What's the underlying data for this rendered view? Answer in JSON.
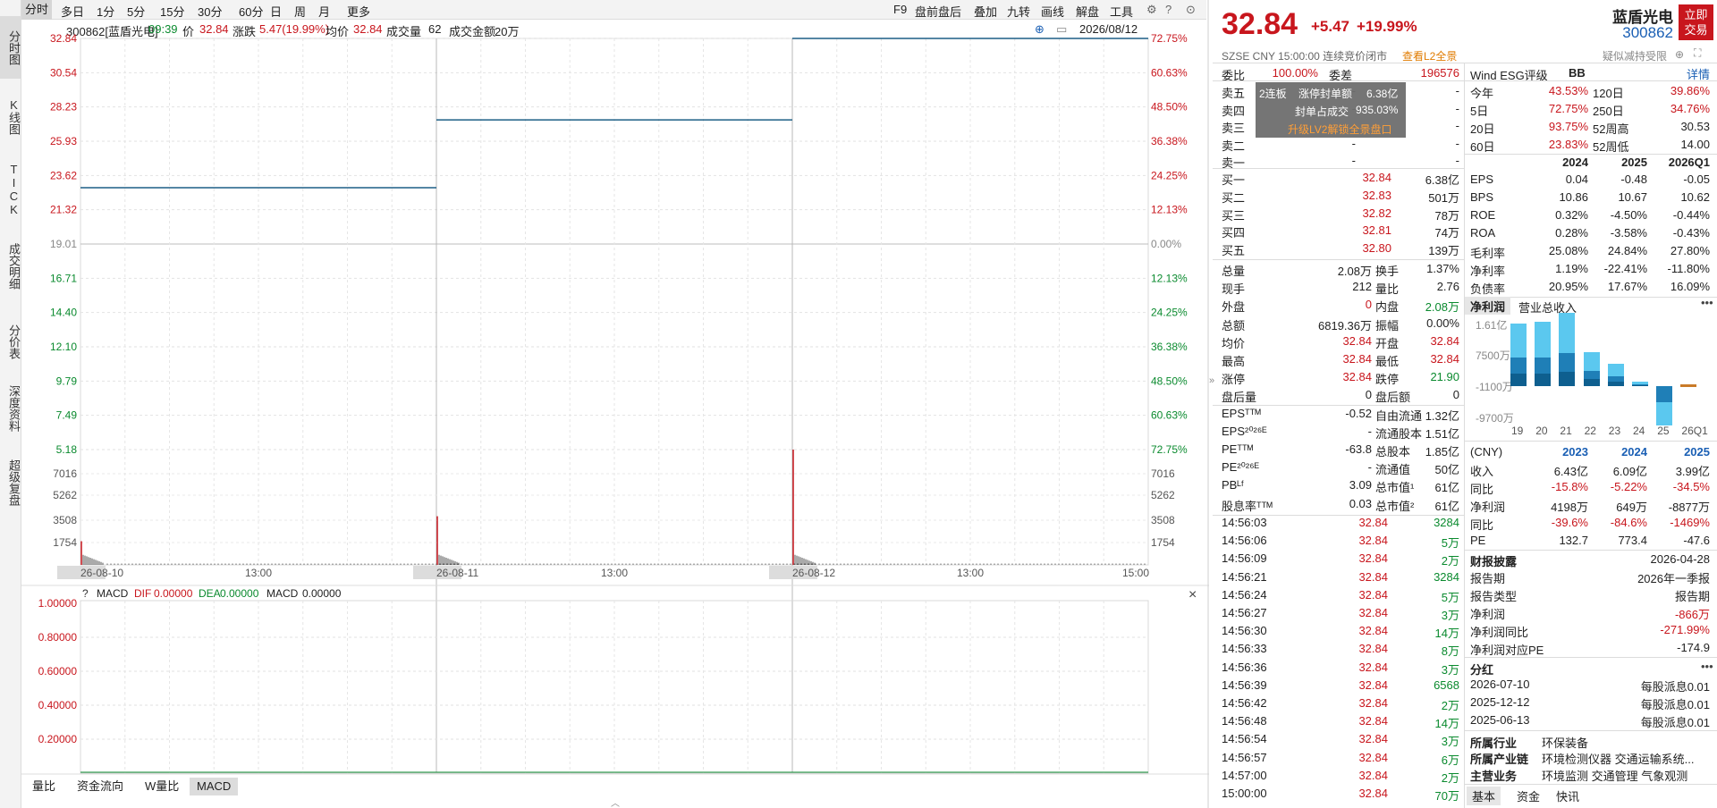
{
  "left_nav": [
    {
      "label": "分时图",
      "active": true
    },
    {
      "label": "K线图"
    },
    {
      "label": "TICK"
    },
    {
      "label": "成交明细"
    },
    {
      "label": "分价表"
    },
    {
      "label": "深度资料"
    },
    {
      "label": "超级复盘"
    }
  ],
  "top_tabs": [
    "分时",
    "多日",
    "1分",
    "5分",
    "15分",
    "30分",
    "60分",
    "日",
    "周",
    "月",
    "更多"
  ],
  "top_right": [
    "F9",
    "盘前盘后",
    "叠加",
    "九转",
    "画线",
    "解盘",
    "工具"
  ],
  "info": {
    "code": "300862[蓝盾光电]",
    "time": "09:39",
    "price_label": "价",
    "price": "32.84",
    "chg_label": "涨跌",
    "chg": "5.47(19.99%)",
    "avg_label": "均价",
    "avg": "32.84",
    "vol_label": "成交量",
    "vol": "62",
    "amt_label": "成交金额",
    "amt": "20万",
    "date": "2026/08/12"
  },
  "chart": {
    "price_ticks": [
      {
        "v": "32.84",
        "c": "red"
      },
      {
        "v": "30.54",
        "c": "red"
      },
      {
        "v": "28.23",
        "c": "red"
      },
      {
        "v": "25.93",
        "c": "red"
      },
      {
        "v": "23.62",
        "c": "red"
      },
      {
        "v": "21.32",
        "c": "red"
      },
      {
        "v": "19.01",
        "c": "gray"
      },
      {
        "v": "16.71",
        "c": "green"
      },
      {
        "v": "14.40",
        "c": "green"
      },
      {
        "v": "12.10",
        "c": "green"
      },
      {
        "v": "9.79",
        "c": "green"
      },
      {
        "v": "7.49",
        "c": "green"
      },
      {
        "v": "5.18",
        "c": "green"
      }
    ],
    "pct_ticks": [
      {
        "v": "72.75%",
        "c": "red"
      },
      {
        "v": "60.63%",
        "c": "red"
      },
      {
        "v": "48.50%",
        "c": "red"
      },
      {
        "v": "36.38%",
        "c": "red"
      },
      {
        "v": "24.25%",
        "c": "red"
      },
      {
        "v": "12.13%",
        "c": "red"
      },
      {
        "v": "0.00%",
        "c": "gray"
      },
      {
        "v": "12.13%",
        "c": "green"
      },
      {
        "v": "24.25%",
        "c": "green"
      },
      {
        "v": "36.38%",
        "c": "green"
      },
      {
        "v": "48.50%",
        "c": "green"
      },
      {
        "v": "60.63%",
        "c": "green"
      },
      {
        "v": "72.75%",
        "c": "green"
      }
    ],
    "vol_ticks": [
      "7016",
      "5262",
      "3508",
      "1754"
    ],
    "time_labels": [
      "26-08-10",
      "13:00",
      "26-08-11",
      "13:00",
      "26-08-12",
      "13:00",
      "15:00"
    ],
    "price_segments": [
      {
        "day": 0,
        "price": 22.8
      },
      {
        "day": 1,
        "price": 27.36
      },
      {
        "day": 2,
        "price": 32.84
      }
    ],
    "price_top": 32.84,
    "price_bottom": 5.18,
    "vol_max": 8770,
    "vol_spikes": [
      {
        "day": 0,
        "v": 1800
      },
      {
        "day": 1,
        "v": 3700
      },
      {
        "day": 2,
        "v": 8770
      }
    ],
    "macd_title": "MACD",
    "macd_dif_label": "DIF",
    "macd_dif": "0.00000",
    "macd_dea_label": "DEA",
    "macd_dea": "0.00000",
    "macd_label": "MACD",
    "macd_val": "0.00000",
    "macd_ticks": [
      "1.00000",
      "0.80000",
      "0.60000",
      "0.40000",
      "0.20000"
    ]
  },
  "bottom_tabs": [
    {
      "label": "量比"
    },
    {
      "label": "资金流向"
    },
    {
      "label": "W量比"
    },
    {
      "label": "MACD",
      "active": true
    }
  ],
  "quote": {
    "name": "蓝盾光电",
    "code": "300862",
    "price": "32.84",
    "chg": "+5.47",
    "pct": "+19.99%",
    "buy_btn": "立即交易",
    "meta": "SZSE  CNY  15:00:00  连续竞价闭市",
    "l2link": "查看L2全景",
    "reduce_note": "疑似减持受限",
    "colors": {
      "up": "#c8161d",
      "down": "#0a8a2e",
      "accent": "#1a5fb4"
    }
  },
  "ob": {
    "weibi_label": "委比",
    "weibi": "100.00%",
    "weicha_label": "委差",
    "weicha": "196576",
    "asks": [
      {
        "l": "卖五",
        "p": "-",
        "v": "-"
      },
      {
        "l": "卖四",
        "p": "-",
        "v": "-"
      },
      {
        "l": "卖三",
        "p": "-",
        "v": "-"
      },
      {
        "l": "卖二",
        "p": "-",
        "v": "-"
      },
      {
        "l": "卖一",
        "p": "-",
        "v": "-"
      }
    ],
    "bids": [
      {
        "l": "买一",
        "p": "32.84",
        "v": "6.38亿"
      },
      {
        "l": "买二",
        "p": "32.83",
        "v": "501万"
      },
      {
        "l": "买三",
        "p": "32.82",
        "v": "78万"
      },
      {
        "l": "买四",
        "p": "32.81",
        "v": "74万"
      },
      {
        "l": "买五",
        "p": "32.80",
        "v": "139万"
      }
    ],
    "l2": {
      "tag": "2连板",
      "seal_label": "涨停封单额",
      "seal": "6.38亿",
      "ratio_label": "封单占成交",
      "ratio": "935.03%",
      "upgrade": "升级LV2解锁全景盘口"
    }
  },
  "stats": [
    [
      {
        "l": "总量",
        "v": "2.08万"
      },
      {
        "l": "换手",
        "v": "1.37%"
      }
    ],
    [
      {
        "l": "现手",
        "v": "212"
      },
      {
        "l": "量比",
        "v": "2.76"
      }
    ],
    [
      {
        "l": "外盘",
        "v": "0",
        "c": "red"
      },
      {
        "l": "内盘",
        "v": "2.08万",
        "c": "green"
      }
    ],
    [
      {
        "l": "总额",
        "v": "6819.36万"
      },
      {
        "l": "振幅",
        "v": "0.00%"
      }
    ],
    [
      {
        "l": "均价",
        "v": "32.84",
        "c": "red"
      },
      {
        "l": "开盘",
        "v": "32.84",
        "c": "red"
      }
    ],
    [
      {
        "l": "最高",
        "v": "32.84",
        "c": "red"
      },
      {
        "l": "最低",
        "v": "32.84",
        "c": "red"
      }
    ],
    [
      {
        "l": "涨停",
        "v": "32.84",
        "c": "red"
      },
      {
        "l": "跌停",
        "v": "21.90",
        "c": "green"
      }
    ],
    [
      {
        "l": "盘后量",
        "v": "0"
      },
      {
        "l": "盘后额",
        "v": "0"
      }
    ],
    [
      {
        "l": "EPSᵀᵀᴹ",
        "v": "-0.52"
      },
      {
        "l": "自由流通",
        "v": "1.32亿"
      }
    ],
    [
      {
        "l": "EPS²⁰²⁶ᴱ",
        "v": "-"
      },
      {
        "l": "流通股本",
        "v": "1.51亿"
      }
    ],
    [
      {
        "l": "PEᵀᵀᴹ",
        "v": "-63.8"
      },
      {
        "l": "总股本",
        "v": "1.85亿"
      }
    ],
    [
      {
        "l": "PE²⁰²⁶ᴱ",
        "v": "-"
      },
      {
        "l": "流通值",
        "v": "50亿"
      }
    ],
    [
      {
        "l": "PBᴸᶠ",
        "v": "3.09"
      },
      {
        "l": "总市值¹",
        "v": "61亿"
      }
    ],
    [
      {
        "l": "股息率ᵀᵀᴹ",
        "v": "0.03"
      },
      {
        "l": "总市值²",
        "v": "61亿"
      }
    ]
  ],
  "ticks": [
    {
      "t": "14:56:03",
      "p": "32.84",
      "v": "3284"
    },
    {
      "t": "14:56:06",
      "p": "32.84",
      "v": "5万"
    },
    {
      "t": "14:56:09",
      "p": "32.84",
      "v": "2万"
    },
    {
      "t": "14:56:21",
      "p": "32.84",
      "v": "3284"
    },
    {
      "t": "14:56:24",
      "p": "32.84",
      "v": "5万"
    },
    {
      "t": "14:56:27",
      "p": "32.84",
      "v": "3万"
    },
    {
      "t": "14:56:30",
      "p": "32.84",
      "v": "14万"
    },
    {
      "t": "14:56:33",
      "p": "32.84",
      "v": "8万"
    },
    {
      "t": "14:56:36",
      "p": "32.84",
      "v": "3万"
    },
    {
      "t": "14:56:39",
      "p": "32.84",
      "v": "6568"
    },
    {
      "t": "14:56:42",
      "p": "32.84",
      "v": "2万"
    },
    {
      "t": "14:56:48",
      "p": "32.84",
      "v": "14万"
    },
    {
      "t": "14:56:54",
      "p": "32.84",
      "v": "3万"
    },
    {
      "t": "14:56:57",
      "p": "32.84",
      "v": "6万"
    },
    {
      "t": "14:57:00",
      "p": "32.84",
      "v": "2万"
    },
    {
      "t": "15:00:00",
      "p": "32.84",
      "v": "70万"
    }
  ],
  "fin": {
    "esg_label": "Wind ESG评级",
    "esg": "BB",
    "detail": "详情",
    "perf": [
      [
        {
          "l": "今年",
          "v": "43.53%"
        },
        {
          "l": "120日",
          "v": "39.86%"
        }
      ],
      [
        {
          "l": "5日",
          "v": "72.75%"
        },
        {
          "l": "250日",
          "v": "34.76%"
        }
      ],
      [
        {
          "l": "20日",
          "v": "93.75%"
        },
        {
          "l": "52周高",
          "v": "30.53"
        }
      ],
      [
        {
          "l": "60日",
          "v": "23.83%"
        },
        {
          "l": "52周低",
          "v": "14.00"
        }
      ]
    ],
    "years": [
      "2024",
      "2025",
      "2026Q1"
    ],
    "metrics": [
      {
        "l": "EPS",
        "v": [
          "0.04",
          "-0.48",
          "-0.05"
        ]
      },
      {
        "l": "BPS",
        "v": [
          "10.86",
          "10.67",
          "10.62"
        ]
      },
      {
        "l": "ROE",
        "v": [
          "0.32%",
          "-4.50%",
          "-0.44%"
        ]
      },
      {
        "l": "ROA",
        "v": [
          "0.28%",
          "-3.58%",
          "-0.43%"
        ]
      },
      {
        "l": "毛利率",
        "v": [
          "25.08%",
          "24.84%",
          "27.80%"
        ]
      },
      {
        "l": "净利率",
        "v": [
          "1.19%",
          "-22.41%",
          "-11.80%"
        ]
      },
      {
        "l": "负债率",
        "v": [
          "20.95%",
          "17.67%",
          "16.09%"
        ]
      }
    ],
    "tab1": "净利润",
    "tab2": "营业总收入",
    "chart_y": [
      "1.61亿",
      "7500万",
      "-1100万",
      "-9700万"
    ],
    "chart_x": [
      "19",
      "20",
      "21",
      "22",
      "23",
      "24",
      "25",
      "26Q1"
    ],
    "bar_values": [
      1.35,
      1.38,
      1.58,
      0.74,
      0.48,
      0.1,
      -0.85,
      -0.09
    ],
    "cny": "(CNY)",
    "y3": [
      "2023",
      "2024",
      "2025"
    ],
    "income": [
      {
        "l": "收入",
        "v": [
          "6.43亿",
          "6.09亿",
          "3.99亿"
        ]
      },
      {
        "l": "同比",
        "v": [
          "-15.8%",
          "-5.22%",
          "-34.5%"
        ],
        "c": "red"
      },
      {
        "l": "净利润",
        "v": [
          "4198万",
          "649万",
          "-8877万"
        ]
      },
      {
        "l": "同比",
        "v": [
          "-39.6%",
          "-84.6%",
          "-1469%"
        ],
        "c": "red"
      },
      {
        "l": "PE",
        "v": [
          "132.7",
          "773.4",
          "-47.6"
        ]
      }
    ],
    "report_title": "财报披露",
    "report_date": "2026-04-28",
    "report": [
      {
        "l": "报告期",
        "v": "2026年一季报"
      },
      {
        "l": "报告类型",
        "v": "报告期"
      },
      {
        "l": "净利润",
        "v": "-866万",
        "c": "red"
      },
      {
        "l": "净利润同比",
        "v": "-271.99%",
        "c": "red"
      },
      {
        "l": "净利润对应PE",
        "v": "-174.9"
      }
    ],
    "div_title": "分红",
    "divs": [
      {
        "d": "2026-07-10",
        "v": "每股派息0.01"
      },
      {
        "d": "2025-12-12",
        "v": "每股派息0.01"
      },
      {
        "d": "2025-06-13",
        "v": "每股派息0.01"
      }
    ],
    "ind_label": "所属行业",
    "ind": "环保装备",
    "chain_label": "所属产业链",
    "chain": "环境检测仪器  交通运输系统...",
    "biz_label": "主营业务",
    "biz": "环境监测  交通管理  气象观测",
    "bottom_tabs": [
      "基本",
      "资金",
      "快讯"
    ]
  }
}
